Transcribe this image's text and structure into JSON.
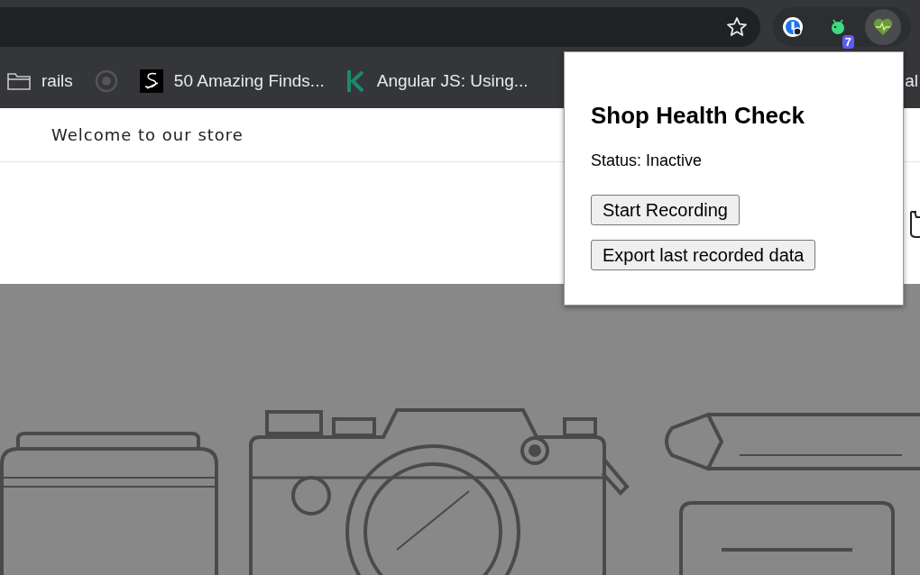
{
  "browser": {
    "extensions": [
      {
        "kind": "password",
        "selected": false
      },
      {
        "kind": "bug",
        "badge": "7",
        "selected": false
      },
      {
        "kind": "heart",
        "selected": true
      }
    ],
    "bookmarks": [
      {
        "kind": "folder",
        "label": "rails"
      },
      {
        "kind": "github"
      },
      {
        "kind": "logo",
        "label": "50 Amazing Finds..."
      },
      {
        "kind": "k",
        "label": "Angular JS: Using..."
      },
      {
        "kind": "plain",
        "label": "al"
      }
    ]
  },
  "store": {
    "announcement": "Welcome to our store"
  },
  "popup": {
    "title": "Shop Health Check",
    "status": "Status: Inactive",
    "buttons": [
      "Start Recording",
      "Export last recorded data"
    ]
  }
}
